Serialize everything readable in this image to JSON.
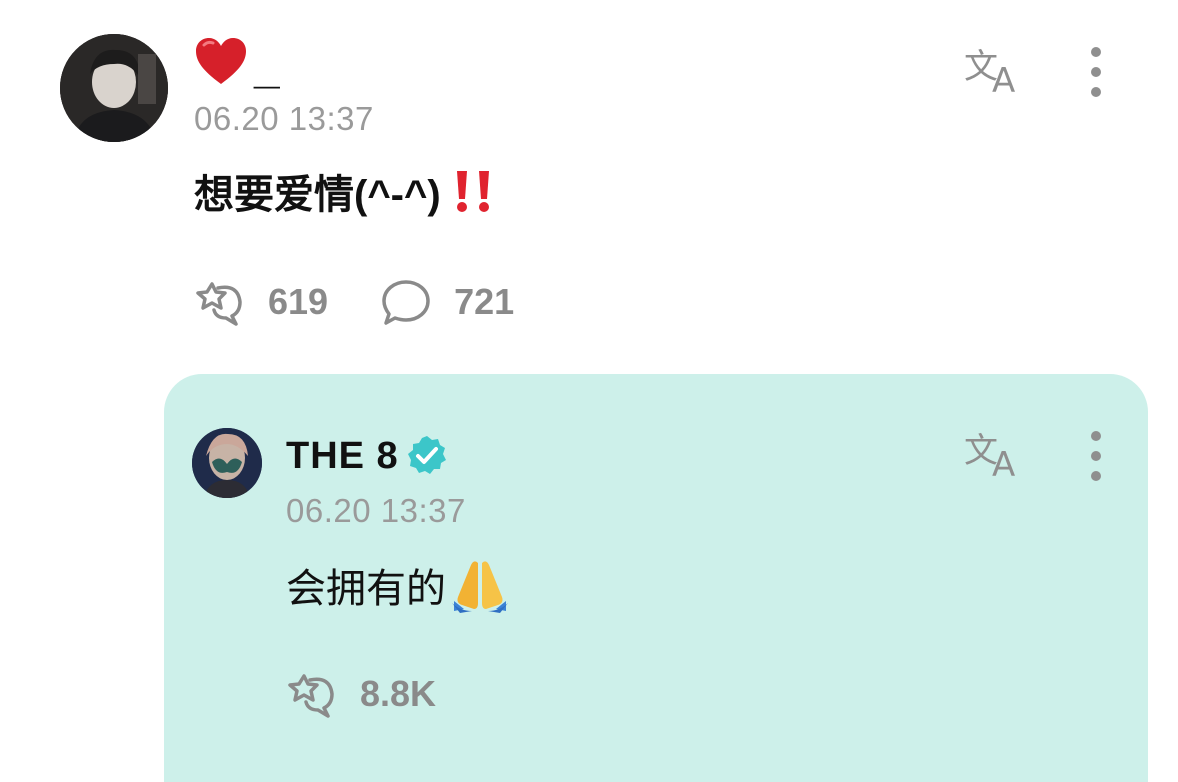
{
  "post": {
    "author_name": "_",
    "author_icon": "heart-icon",
    "timestamp": "06.20 13:37",
    "body_text": "想要爱情(^-^)",
    "body_emoji": "double-exclamation-icon",
    "likes_count": "619",
    "comments_count": "721",
    "translate_icon": "translate-icon",
    "more_icon": "more-vertical-icon"
  },
  "reply": {
    "author_name": "THE 8",
    "verified_icon": "verified-badge-icon",
    "timestamp": "06.20 13:37",
    "body_text": "会拥有的",
    "body_emoji": "folded-hands-icon",
    "likes_count": "8.8K",
    "translate_icon": "translate-icon",
    "more_icon": "more-vertical-icon"
  },
  "colors": {
    "reply_background": "#cdf0ea",
    "timestamp": "#9a9a9a",
    "stat_text": "#8a8a8a",
    "heart": "#d6202a",
    "verified": "#3cc6c9"
  }
}
